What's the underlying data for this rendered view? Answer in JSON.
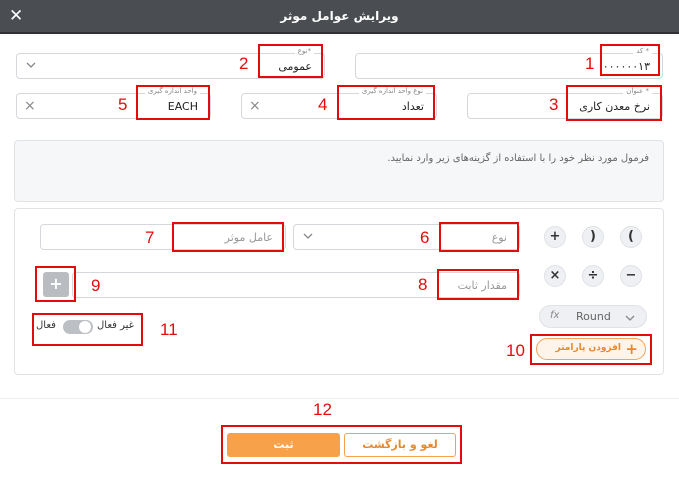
{
  "dialog": {
    "title": "ویرایش عوامل موثر"
  },
  "fields": {
    "code": {
      "label": "کد *",
      "value": "۰۰۰۰۰۰۱۳"
    },
    "type": {
      "label": "نوع*",
      "value": "عمومی"
    },
    "title": {
      "label": "عنوان *",
      "value": "نرخ معدن کاری"
    },
    "unit_type": {
      "label": "نوع واحد اندازه گیری",
      "value": "تعداد"
    },
    "unit": {
      "label": "واحد اندازه گیری",
      "value": "EACH"
    }
  },
  "formula": {
    "hint": "فرمول مورد نظر خود را با استفاده از گزینه‌های زیر وارد نمایید."
  },
  "builder": {
    "type_placeholder": "نوع",
    "factor_placeholder": "عامل موثر",
    "constant_placeholder": "مقدار ثابت",
    "operators": [
      "(",
      ")",
      "+",
      "−",
      "÷",
      "×"
    ],
    "fx": "fx",
    "round_label": "Round",
    "add_param_label": "افزودن پارامتر",
    "plus_symbol": "+"
  },
  "status": {
    "active_label": "فعال",
    "inactive_label": "غیر فعال",
    "is_active": false
  },
  "actions": {
    "save_label": "ثبت",
    "cancel_label": "لغو و بازگشت"
  },
  "annotations": [
    "1",
    "2",
    "3",
    "4",
    "5",
    "6",
    "7",
    "8",
    "9",
    "10",
    "11",
    "12"
  ],
  "colors": {
    "titlebar": "#4a4d52",
    "accent": "#f7a24b",
    "annotation": "#e10c0c"
  }
}
